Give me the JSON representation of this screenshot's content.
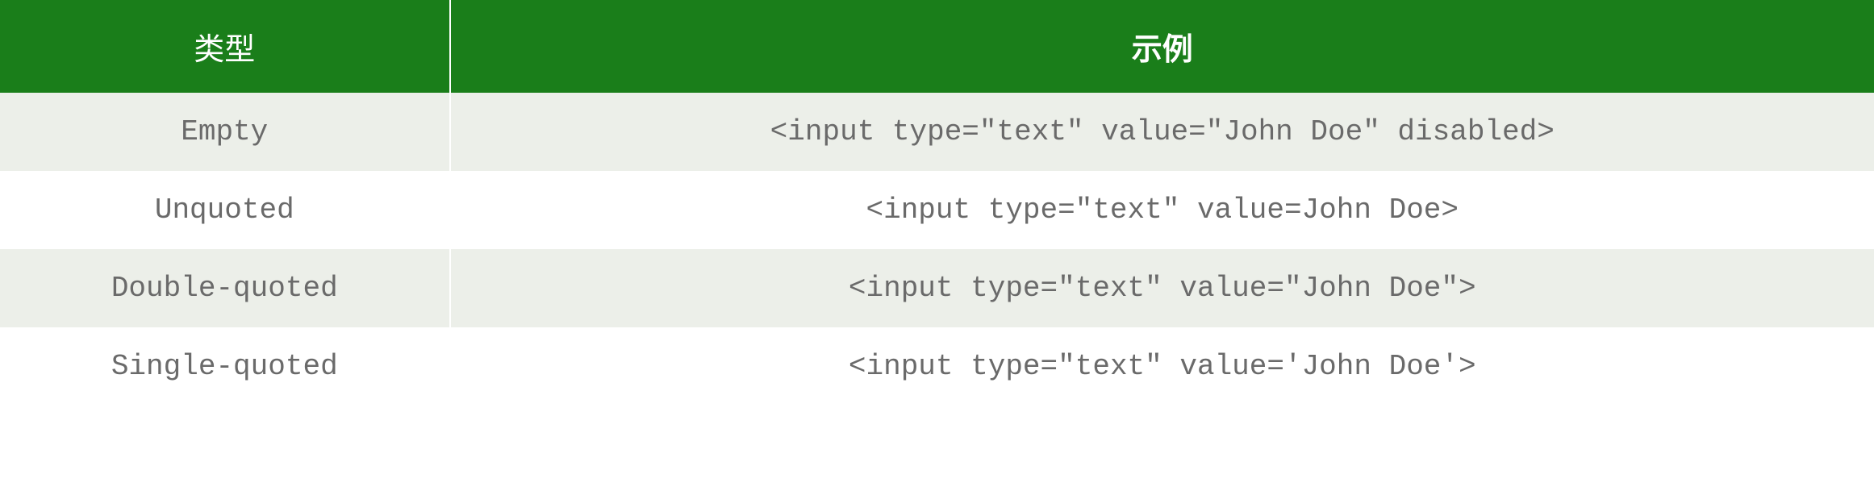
{
  "table": {
    "headers": {
      "type": "类型",
      "example": "示例"
    },
    "rows": [
      {
        "type": "Empty",
        "example": "<input type=\"text\" value=\"John Doe\" disabled>"
      },
      {
        "type": "Unquoted",
        "example": "<input type=\"text\" value=John Doe>"
      },
      {
        "type": "Double-quoted",
        "example": "<input type=\"text\" value=\"John Doe\">"
      },
      {
        "type": "Single-quoted",
        "example": "<input type=\"text\" value='John Doe'>"
      }
    ]
  }
}
